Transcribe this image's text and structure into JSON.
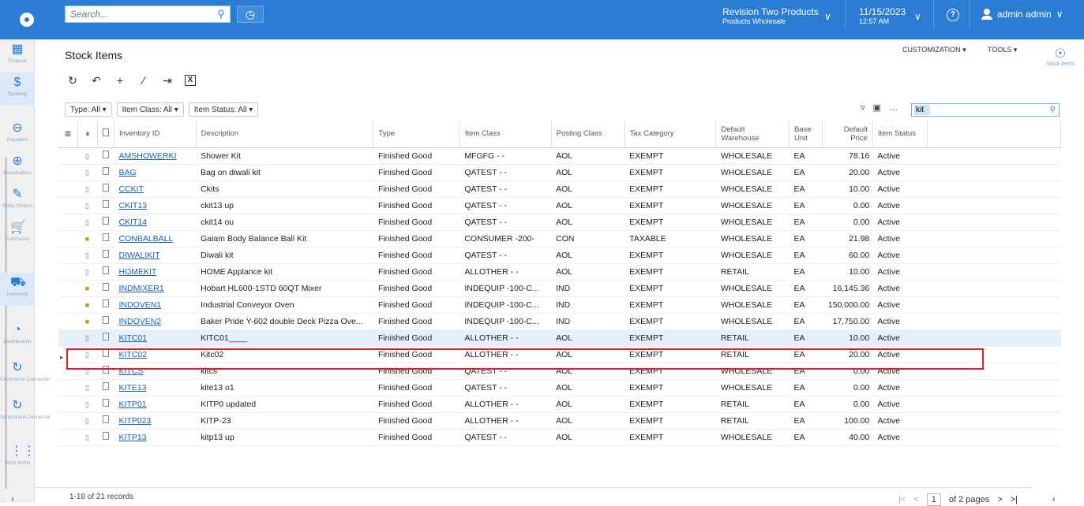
{
  "header": {
    "search_placeholder": "Search...",
    "tenant": "Revision Two Products",
    "branch": "Products Wholesale",
    "date": "11/15/2023",
    "time": "12:57 AM",
    "user": "admin admin"
  },
  "nav": [
    {
      "label": "Finance",
      "icon": "calculator-icon",
      "glyph": "▦"
    },
    {
      "label": "Banking",
      "icon": "dollar-icon",
      "glyph": "$"
    },
    {
      "label": "Payables",
      "icon": "minus-circle-icon",
      "glyph": "⊖"
    },
    {
      "label": "Receivables",
      "icon": "plus-circle-icon",
      "glyph": "⊕"
    },
    {
      "label": "Sales Orders",
      "icon": "pencil-box-icon",
      "glyph": "✎"
    },
    {
      "label": "Purchases",
      "icon": "cart-icon",
      "glyph": "🛒"
    },
    {
      "label": "Inventory",
      "icon": "truck-icon",
      "glyph": "⛟"
    },
    {
      "label": "Dashboards",
      "icon": "gauge-icon",
      "glyph": "◔"
    },
    {
      "label": "Commerce Connector",
      "icon": "sync-icon",
      "glyph": "↻"
    },
    {
      "label": "Sellercloud Connector",
      "icon": "sync-icon",
      "glyph": "↻"
    },
    {
      "label": "More Items",
      "icon": "grid-dots-icon",
      "glyph": "⋮⋮"
    }
  ],
  "page": {
    "title": "Stock Items",
    "customization": "CUSTOMIZATION ▾",
    "tools": "TOOLS ▾",
    "right_panel_label": "Stock Items"
  },
  "filters": [
    "Type: All ▾",
    "Item Class: All ▾",
    "Item Status: All ▾"
  ],
  "grid_search": "kit",
  "columns": [
    "Inventory ID",
    "Description",
    "Type",
    "Item Class",
    "Posting Class",
    "Tax Category",
    "Default Warehouse",
    "Base Unit",
    "Default Price",
    "Item Status"
  ],
  "rows": [
    {
      "clip": false,
      "id": "AMSHOWERKI",
      "desc": "Shower Kit",
      "type": "Finished Good",
      "cls": "MFGFG - -",
      "post": "AOL",
      "tax": "EXEMPT",
      "wh": "WHOLESALE",
      "unit": "EA",
      "price": "78.16",
      "status": "Active"
    },
    {
      "clip": false,
      "id": "BAG",
      "desc": "Bag on diwali kit",
      "type": "Finished Good",
      "cls": "QATEST - -",
      "post": "AOL",
      "tax": "EXEMPT",
      "wh": "WHOLESALE",
      "unit": "EA",
      "price": "20.00",
      "status": "Active"
    },
    {
      "clip": false,
      "id": "CCKIT",
      "desc": "Ckits",
      "type": "Finished Good",
      "cls": "QATEST - -",
      "post": "AOL",
      "tax": "EXEMPT",
      "wh": "WHOLESALE",
      "unit": "EA",
      "price": "10.00",
      "status": "Active"
    },
    {
      "clip": false,
      "id": "CKIT13",
      "desc": "ckit13 up",
      "type": "Finished Good",
      "cls": "QATEST - -",
      "post": "AOL",
      "tax": "EXEMPT",
      "wh": "WHOLESALE",
      "unit": "EA",
      "price": "0.00",
      "status": "Active"
    },
    {
      "clip": false,
      "id": "CKIT14",
      "desc": "ckit14 ou",
      "type": "Finished Good",
      "cls": "QATEST - -",
      "post": "AOL",
      "tax": "EXEMPT",
      "wh": "WHOLESALE",
      "unit": "EA",
      "price": "0.00",
      "status": "Active"
    },
    {
      "clip": true,
      "id": "CONBALBALL",
      "desc": "Gaiam Body Balance Ball Kit",
      "type": "Finished Good",
      "cls": "CONSUMER -200-",
      "post": "CON",
      "tax": "TAXABLE",
      "wh": "WHOLESALE",
      "unit": "EA",
      "price": "21.98",
      "status": "Active"
    },
    {
      "clip": false,
      "id": "DIWALIKIT",
      "desc": "Diwali kit",
      "type": "Finished Good",
      "cls": "QATEST - -",
      "post": "AOL",
      "tax": "EXEMPT",
      "wh": "WHOLESALE",
      "unit": "EA",
      "price": "60.00",
      "status": "Active"
    },
    {
      "clip": false,
      "id": "HOMEKIT",
      "desc": "HOME Applance kit",
      "type": "Finished Good",
      "cls": "ALLOTHER - -",
      "post": "AOL",
      "tax": "EXEMPT",
      "wh": "RETAIL",
      "unit": "EA",
      "price": "10.00",
      "status": "Active"
    },
    {
      "clip": true,
      "id": "INDMIXER1",
      "desc": "Hobart HL600-1STD 60QT Mixer",
      "type": "Finished Good",
      "cls": "INDEQUIP -100-C...",
      "post": "IND",
      "tax": "EXEMPT",
      "wh": "WHOLESALE",
      "unit": "EA",
      "price": "16,145.36",
      "status": "Active"
    },
    {
      "clip": true,
      "id": "INDOVEN1",
      "desc": "Industrial Conveyor Oven",
      "type": "Finished Good",
      "cls": "INDEQUIP -100-C...",
      "post": "IND",
      "tax": "EXEMPT",
      "wh": "WHOLESALE",
      "unit": "EA",
      "price": "150,000.00",
      "status": "Active"
    },
    {
      "clip": true,
      "id": "INDOVEN2",
      "desc": "Baker Pride Y-602 double Deck Pizza Ove...",
      "type": "Finished Good",
      "cls": "INDEQUIP -100-C...",
      "post": "IND",
      "tax": "EXEMPT",
      "wh": "WHOLESALE",
      "unit": "EA",
      "price": "17,750.00",
      "status": "Active"
    },
    {
      "clip": false,
      "id": "KITC01",
      "desc": "KITC01____",
      "type": "Finished Good",
      "cls": "ALLOTHER - -",
      "post": "AOL",
      "tax": "EXEMPT",
      "wh": "RETAIL",
      "unit": "EA",
      "price": "10.00",
      "status": "Active",
      "selected": true
    },
    {
      "clip": false,
      "id": "KITC02",
      "desc": "Kitc02",
      "type": "Finished Good",
      "cls": "ALLOTHER - -",
      "post": "AOL",
      "tax": "EXEMPT",
      "wh": "RETAIL",
      "unit": "EA",
      "price": "20.00",
      "status": "Active"
    },
    {
      "clip": false,
      "id": "KITCS",
      "desc": "kitcs",
      "type": "Finished Good",
      "cls": "QATEST - -",
      "post": "AOL",
      "tax": "EXEMPT",
      "wh": "WHOLESALE",
      "unit": "EA",
      "price": "0.00",
      "status": "Active"
    },
    {
      "clip": false,
      "id": "KITE13",
      "desc": "kite13 o1",
      "type": "Finished Good",
      "cls": "QATEST - -",
      "post": "AOL",
      "tax": "EXEMPT",
      "wh": "WHOLESALE",
      "unit": "EA",
      "price": "0.00",
      "status": "Active"
    },
    {
      "clip": false,
      "id": "KITP01",
      "desc": "KITP0 updated",
      "type": "Finished Good",
      "cls": "ALLOTHER - -",
      "post": "AOL",
      "tax": "EXEMPT",
      "wh": "RETAIL",
      "unit": "EA",
      "price": "0.00",
      "status": "Active"
    },
    {
      "clip": false,
      "id": "KITP023",
      "desc": "KITP-23",
      "type": "Finished Good",
      "cls": "ALLOTHER - -",
      "post": "AOL",
      "tax": "EXEMPT",
      "wh": "RETAIL",
      "unit": "EA",
      "price": "100.00",
      "status": "Active"
    },
    {
      "clip": false,
      "id": "KITP13",
      "desc": "kitp13 up",
      "type": "Finished Good",
      "cls": "QATEST - -",
      "post": "AOL",
      "tax": "EXEMPT",
      "wh": "WHOLESALE",
      "unit": "EA",
      "price": "40.00",
      "status": "Active"
    }
  ],
  "footer": {
    "records": "1-18 of 21 records",
    "page": "1",
    "of_pages": "of 2 pages"
  }
}
